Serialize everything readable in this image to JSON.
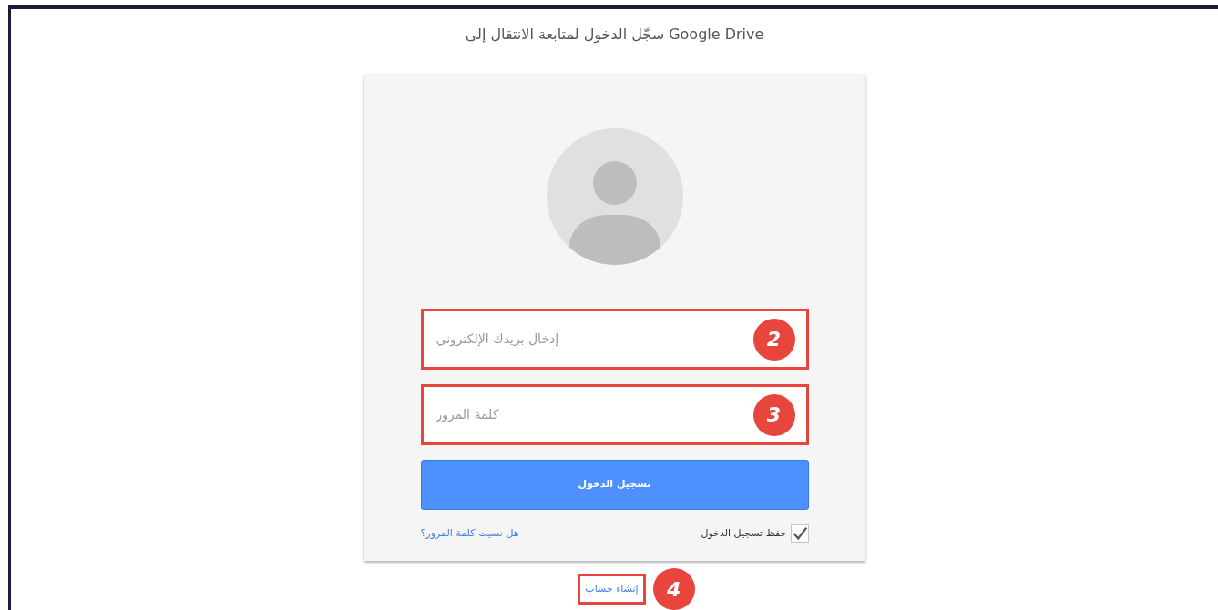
{
  "heading": "سجّل الدخول لمتابعة الانتقال إلى Google Drive",
  "fields": [
    {
      "placeholder": "إدخال بريدك الإلكتروني",
      "annotation": "2"
    },
    {
      "placeholder": "كلمة المرور",
      "annotation": "3"
    }
  ],
  "submit": "تسجيل الدخول",
  "remember": {
    "label": "حفظ تسجيل الدخول",
    "checked": true
  },
  "forgot_link": "هل نسيت كلمة المرور؟",
  "create_account": {
    "label": "إنشاء حساب",
    "annotation": "4"
  }
}
